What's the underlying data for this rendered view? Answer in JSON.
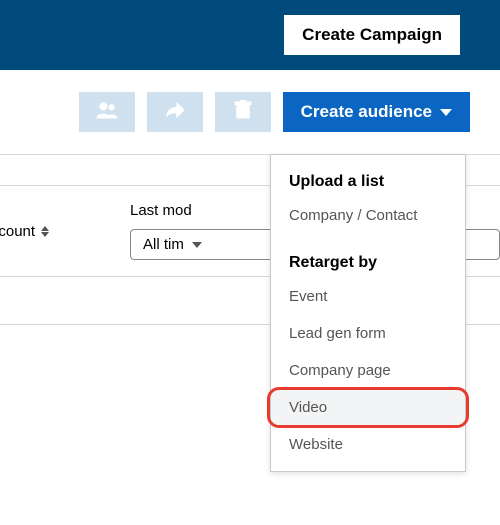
{
  "header": {
    "create_campaign_label": "Create Campaign"
  },
  "toolbar": {
    "create_audience_label": "Create audience"
  },
  "table": {
    "col_count_label": "nce count",
    "col_lastmod_label": "Last mod",
    "filter_all_time_label": "All tim"
  },
  "dropdown": {
    "section_upload_title": "Upload a list",
    "item_company_contact": "Company / Contact",
    "section_retarget_title": "Retarget by",
    "item_event": "Event",
    "item_leadgen": "Lead gen form",
    "item_company_page": "Company page",
    "item_video": "Video",
    "item_website": "Website"
  }
}
